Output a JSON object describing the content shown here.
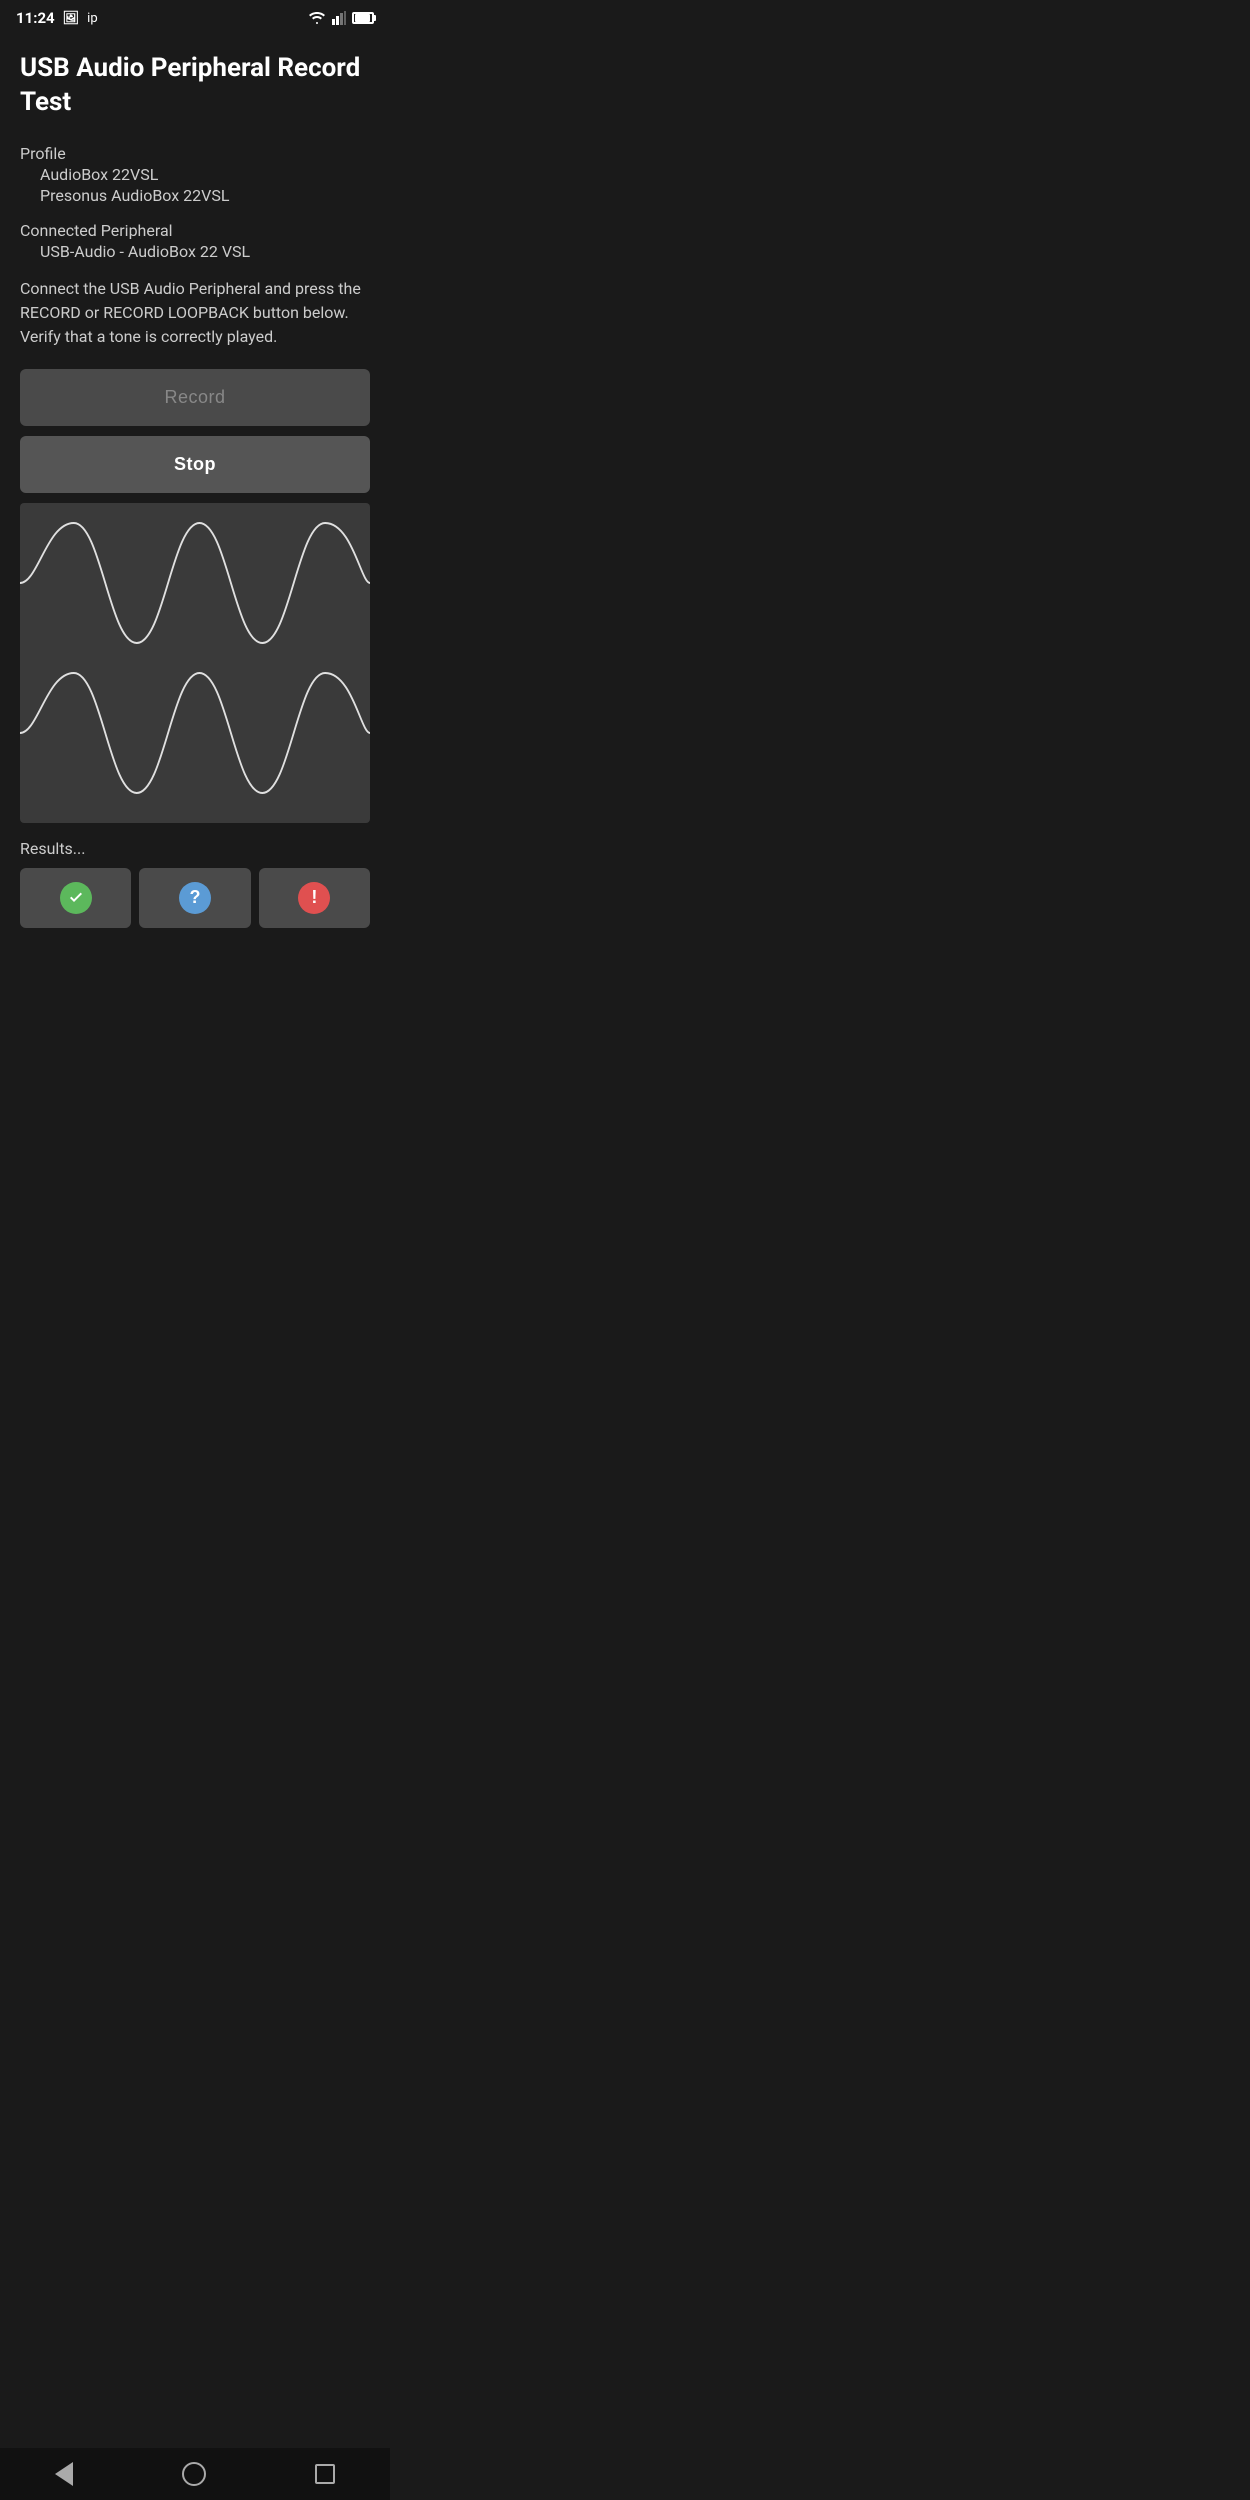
{
  "status_bar": {
    "time": "11:24",
    "icons": [
      "image",
      "ip"
    ]
  },
  "header": {
    "title": "USB Audio Peripheral Record Test"
  },
  "profile": {
    "label": "Profile",
    "name": "AudioBox 22VSL",
    "model": "Presonus AudioBox 22VSL"
  },
  "connected_peripheral": {
    "label": "Connected Peripheral",
    "device": "USB-Audio - AudioBox 22 VSL"
  },
  "description": "Connect the USB Audio Peripheral and press the RECORD or RECORD LOOPBACK button below. Verify that a tone is correctly played.",
  "buttons": {
    "record_label": "Record",
    "stop_label": "Stop"
  },
  "results": {
    "label": "Results...",
    "buttons": [
      {
        "id": "success",
        "icon_type": "check",
        "aria": "Success"
      },
      {
        "id": "question",
        "icon_type": "question",
        "aria": "Unknown"
      },
      {
        "id": "error",
        "icon_type": "exclamation",
        "aria": "Error"
      }
    ]
  },
  "nav": {
    "back_label": "Back",
    "home_label": "Home",
    "recents_label": "Recents"
  }
}
